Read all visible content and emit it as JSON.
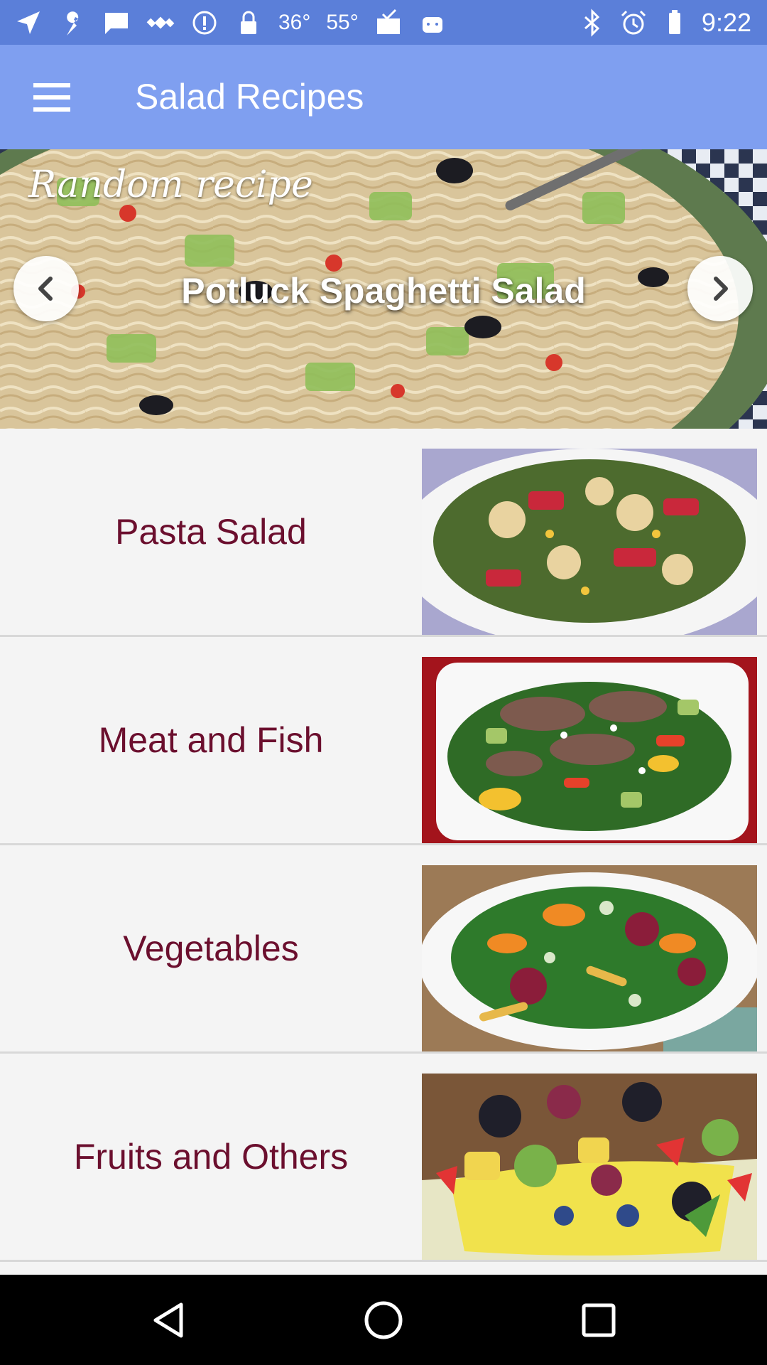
{
  "status_bar": {
    "temperature_1": "36°",
    "temperature_2": "55°",
    "time": "9:22",
    "icons_left": [
      "navigation-icon",
      "wrench-icon",
      "message-icon",
      "satellite-icon",
      "info-icon",
      "lock-icon",
      "mail-check-icon",
      "android-icon"
    ],
    "icons_right": [
      "bluetooth-icon",
      "alarm-icon",
      "battery-icon"
    ]
  },
  "app_bar": {
    "title": "Salad Recipes",
    "menu_icon": "hamburger-menu-icon",
    "background": "#7f9ff0"
  },
  "banner": {
    "label": "Random recipe",
    "title": "Potluck Spaghetti Salad",
    "prev_icon": "chevron-left-icon",
    "next_icon": "chevron-right-icon"
  },
  "categories": [
    {
      "label": "Pasta Salad"
    },
    {
      "label": "Meat and Fish"
    },
    {
      "label": "Vegetables"
    },
    {
      "label": "Fruits and Others"
    }
  ],
  "colors": {
    "status_bar": "#5b7fd9",
    "category_text": "#6b0f2e",
    "list_background": "#f4f4f4"
  },
  "nav_bar": {
    "back_icon": "back-triangle-icon",
    "home_icon": "home-circle-icon",
    "recents_icon": "recents-square-icon"
  }
}
